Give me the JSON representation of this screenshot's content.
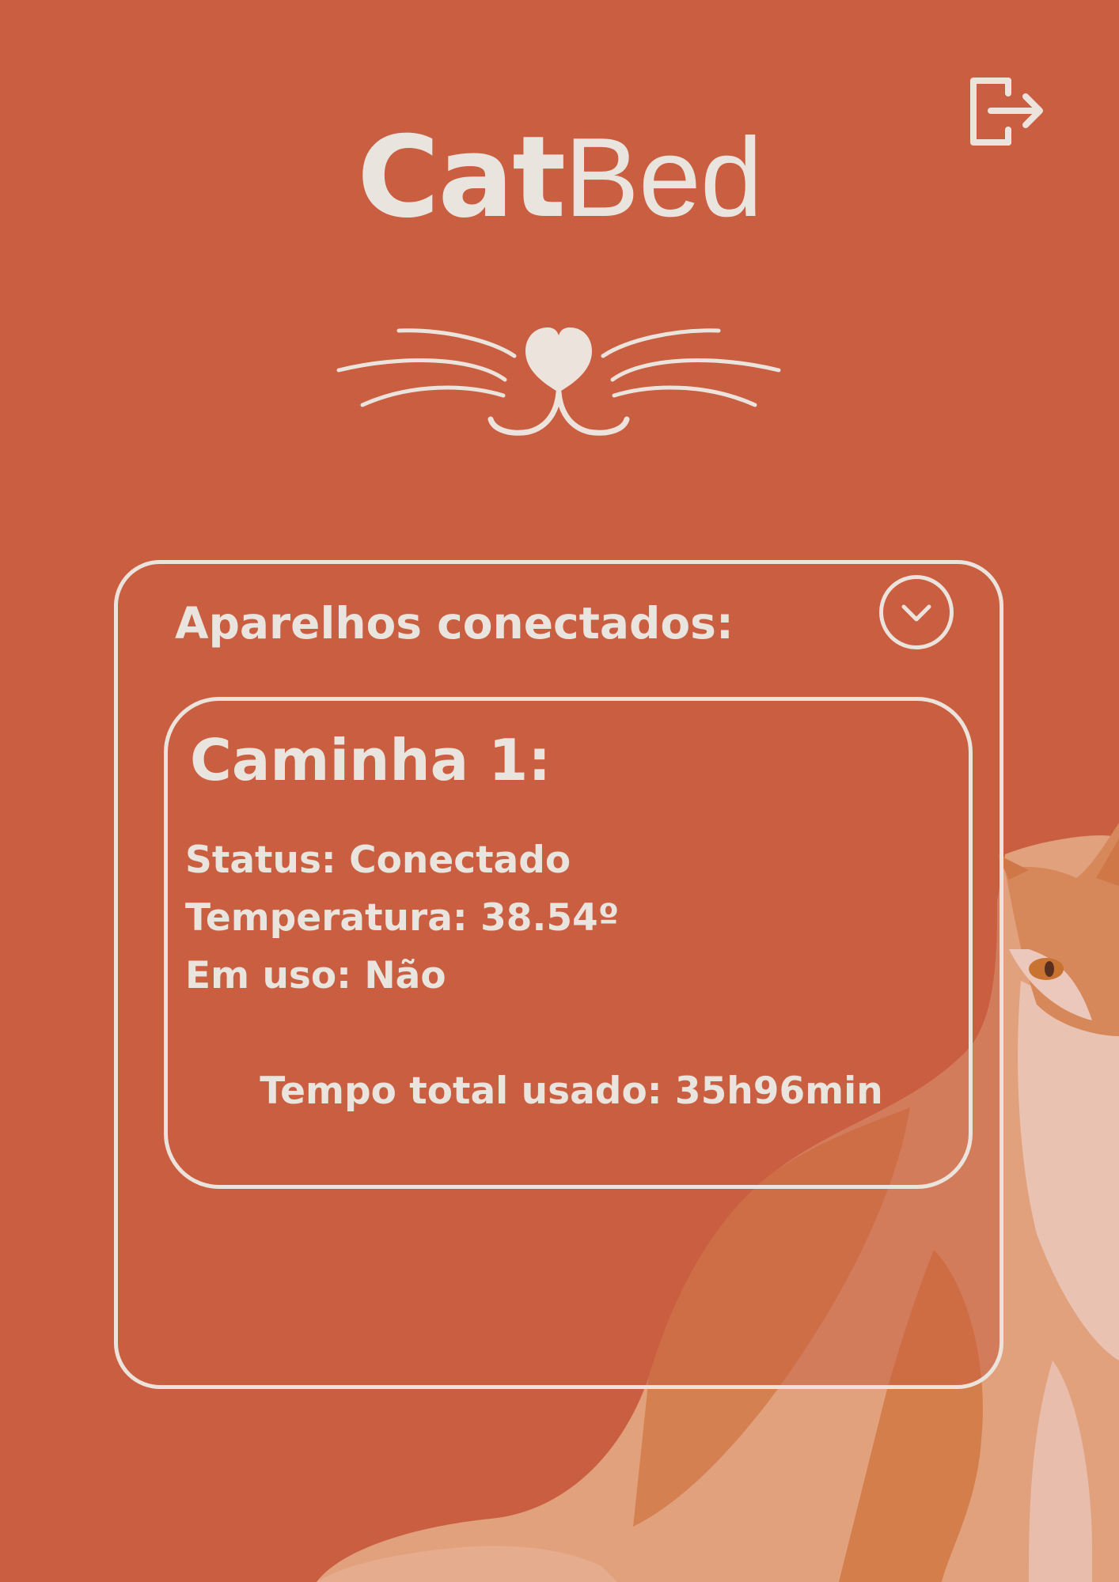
{
  "app": {
    "title_bold": "Cat",
    "title_light": "Bed"
  },
  "colors": {
    "background": "#c95e40",
    "foreground": "#e9e4dd"
  },
  "icons": {
    "logout": "logout-icon",
    "logo": "cat-whiskers-heart-nose-icon",
    "toggle": "chevron-down-icon"
  },
  "panel": {
    "title": "Aparelhos conectados:"
  },
  "device": {
    "name": "Caminha 1:",
    "status_line": "Status: Conectado",
    "temperature_line": "Temperatura: 38.54º",
    "in_use_line": "Em uso: Não",
    "total_time_line": "Tempo total usado: 35h96min"
  }
}
